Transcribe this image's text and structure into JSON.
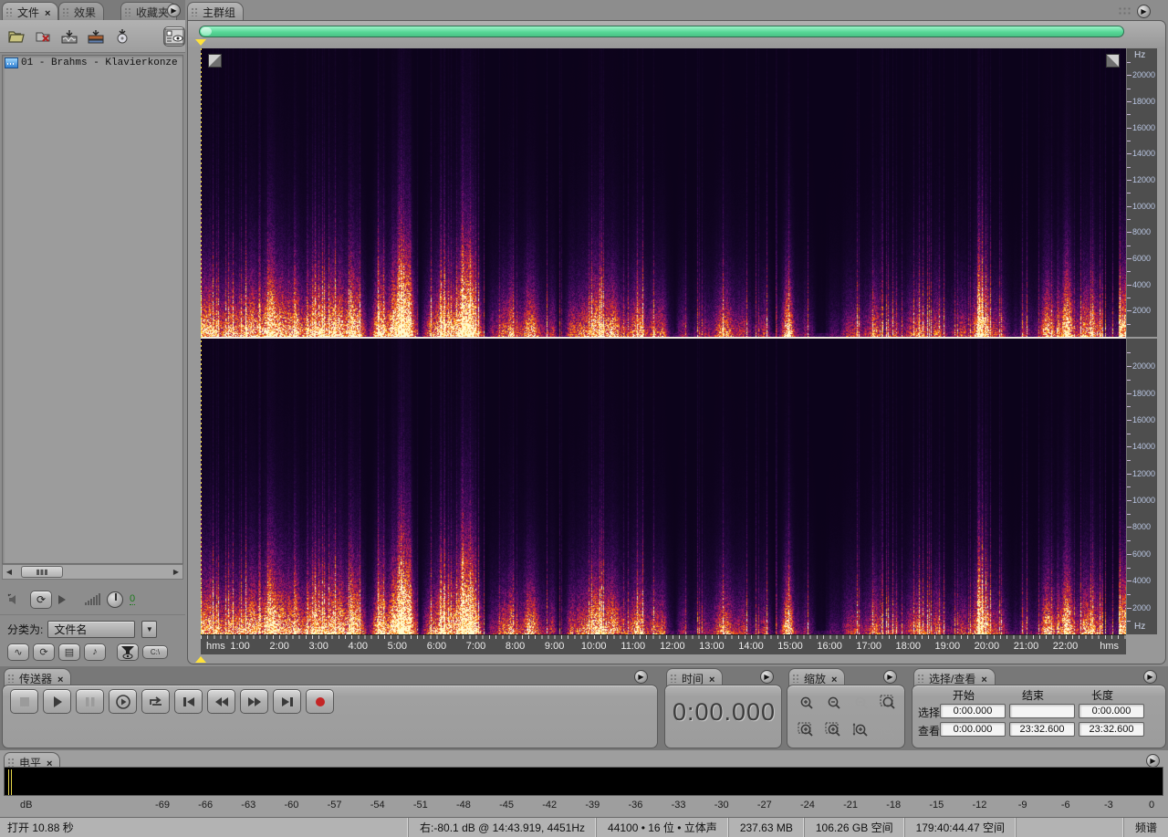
{
  "files_panel": {
    "tabs": [
      {
        "label": "文件",
        "closable": true,
        "active": true
      },
      {
        "label": "效果",
        "closable": false,
        "active": false
      },
      {
        "label": "收藏夹",
        "closable": false,
        "active": false
      }
    ],
    "toolbar_icons": [
      "open-file",
      "close-file",
      "import-file",
      "insert-into-multitrack",
      "insert-into-cd",
      "show-options"
    ],
    "files": [
      {
        "name": "01 - Brahms - Klavierkonze"
      }
    ],
    "preview": {
      "volume": "0"
    },
    "sort": {
      "label": "分类为:",
      "value": "文件名"
    },
    "view_toggles": [
      "show-waveforms",
      "show-loops",
      "show-video",
      "show-audio",
      "filter-view",
      "show-full-path"
    ]
  },
  "main": {
    "tab": "主群组",
    "freq_ruler": {
      "unit": "Hz",
      "labels": [
        20000,
        18000,
        16000,
        14000,
        12000,
        10000,
        8000,
        6000,
        4000,
        2000
      ],
      "max_hz": 22050
    },
    "time_ruler": {
      "unit": "hms",
      "labels": [
        "1:00",
        "2:00",
        "3:00",
        "4:00",
        "5:00",
        "6:00",
        "7:00",
        "8:00",
        "9:00",
        "10:00",
        "11:00",
        "12:00",
        "13:00",
        "14:00",
        "15:00",
        "16:00",
        "17:00",
        "18:00",
        "19:00",
        "20:00",
        "21:00",
        "22:00"
      ],
      "duration_sec": 1412.6
    }
  },
  "transport": {
    "tab": "传送器",
    "buttons": [
      {
        "name": "stop",
        "enabled": false
      },
      {
        "name": "play",
        "enabled": true
      },
      {
        "name": "pause",
        "enabled": false
      },
      {
        "name": "play-spool",
        "enabled": true
      },
      {
        "name": "play-looped",
        "enabled": true
      },
      {
        "name": "go-to-beginning",
        "enabled": true
      },
      {
        "name": "rewind",
        "enabled": true
      },
      {
        "name": "fast-forward",
        "enabled": true
      },
      {
        "name": "go-to-end",
        "enabled": true
      },
      {
        "name": "record",
        "enabled": true
      }
    ]
  },
  "time_panel": {
    "tab": "时间",
    "value": "0:00.000"
  },
  "zoom_panel": {
    "tab": "缩放",
    "buttons": [
      {
        "name": "zoom-in-horizontal",
        "sign": "+",
        "boxed": false,
        "enabled": true
      },
      {
        "name": "zoom-out-horizontal",
        "sign": "−",
        "boxed": false,
        "enabled": true
      },
      {
        "name": "zoom-out-full",
        "sign": "−",
        "boxed": false,
        "enabled": false
      },
      {
        "name": "zoom-to-selection",
        "sign": "",
        "boxed": true,
        "enabled": true
      },
      {
        "name": "zoom-in-left-edge",
        "sign": "+",
        "boxed": true,
        "enabled": true
      },
      {
        "name": "zoom-in-right-edge",
        "sign": "+",
        "boxed": true,
        "enabled": true
      },
      {
        "name": "zoom-in-vertical",
        "sign": "+",
        "boxed": false,
        "enabled": true
      },
      {
        "name": "zoom-out-vertical",
        "sign": "−",
        "boxed": false,
        "enabled": false
      }
    ]
  },
  "selection_panel": {
    "tab": "选择/查看",
    "columns": [
      "开始",
      "结束",
      "长度"
    ],
    "rows": [
      {
        "label": "选择",
        "values": [
          "0:00.000",
          "",
          "0:00.000"
        ]
      },
      {
        "label": "查看",
        "values": [
          "0:00.000",
          "23:32.600",
          "23:32.600"
        ]
      }
    ]
  },
  "levels_panel": {
    "tab": "电平",
    "db_unit": "dB",
    "db_ticks": [
      -69,
      -66,
      -63,
      -60,
      -57,
      -54,
      -51,
      -48,
      -45,
      -42,
      -39,
      -36,
      -33,
      -30,
      -27,
      -24,
      -21,
      -18,
      -15,
      -12,
      -9,
      -6,
      -3,
      0
    ]
  },
  "status_bar": {
    "left": "打开 10.88 秒",
    "segments": [
      "右:-80.1 dB @ 14:43.919, 4451Hz",
      "44100 • 16 位 • 立体声",
      "237.63 MB",
      "106.26 GB 空间",
      "179:40:44.47 空间",
      "",
      "频谱"
    ]
  },
  "colors": {
    "accent_green": "#57d897",
    "record_red": "#c42525",
    "playhead_yellow": "#ffe23a"
  }
}
